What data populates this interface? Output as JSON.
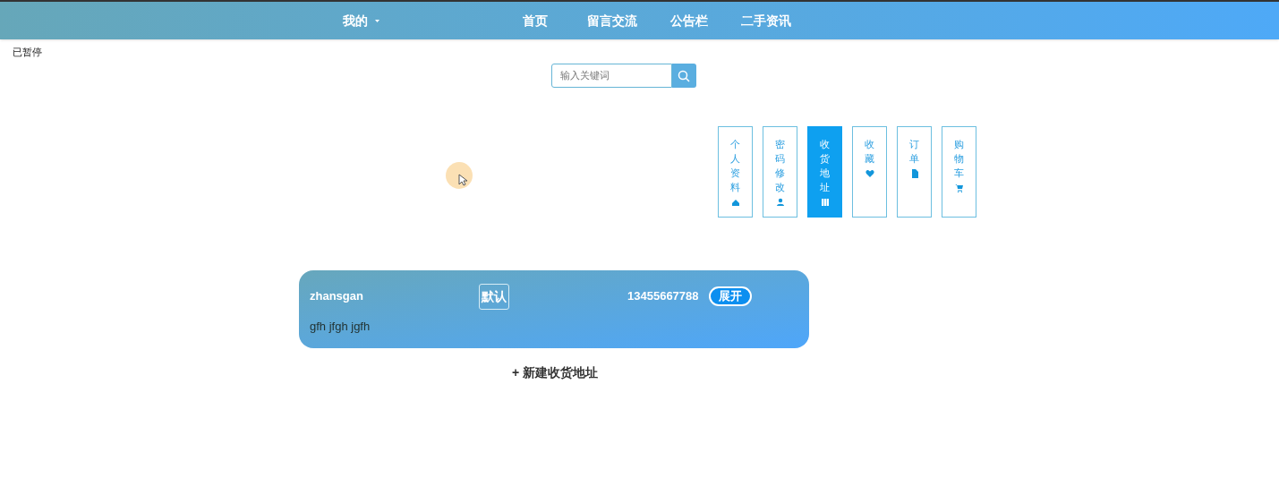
{
  "nav": {
    "menu": {
      "label": "我的"
    },
    "items": [
      {
        "label": "首页"
      },
      {
        "label": "留言交流"
      },
      {
        "label": "公告栏"
      },
      {
        "label": "二手资讯"
      }
    ]
  },
  "video_overlay": {
    "status": "已暂停"
  },
  "search": {
    "placeholder": "输入关键词"
  },
  "tabs": [
    {
      "label": "个人资料",
      "kind": "home",
      "selected": false
    },
    {
      "label": "密码修改",
      "kind": "user",
      "selected": false
    },
    {
      "label": "收货地址",
      "kind": "columns",
      "selected": true
    },
    {
      "label": "收藏",
      "kind": "heart",
      "selected": false
    },
    {
      "label": "订单",
      "kind": "file",
      "selected": false
    },
    {
      "label": "购物车",
      "kind": "cart",
      "selected": false
    }
  ],
  "addresses": [
    {
      "name": "zhansgan",
      "default_tag": "默认",
      "phone": "13455667788",
      "expand_button": "展开",
      "address": "gfh jfgh jgfh"
    }
  ],
  "add_link": "+ 新建收货地址"
}
